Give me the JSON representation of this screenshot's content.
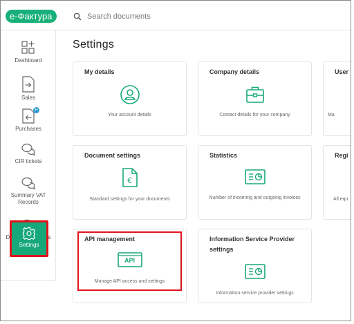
{
  "app": {
    "logo": "e-Фактура"
  },
  "search": {
    "placeholder": "Search documents"
  },
  "page": {
    "title": "Settings"
  },
  "sidebar": {
    "items": [
      {
        "label": "Dashboard"
      },
      {
        "label": "Sales"
      },
      {
        "label": "Purchases",
        "badge": "9+"
      },
      {
        "label": "CIR tickets"
      },
      {
        "label": "Summary VAT Records"
      },
      {
        "label": "Document records"
      },
      {
        "label": "Settings",
        "active": true
      }
    ]
  },
  "cards": [
    {
      "title": "My details",
      "description": "Your account details",
      "icon": "user-icon"
    },
    {
      "title": "Company details",
      "description": "Contact details for your company",
      "icon": "briefcase-icon"
    },
    {
      "title": "User",
      "description": "Ma",
      "icon": "users-icon"
    },
    {
      "title": "Document settings",
      "description": "Standard settings for your documents",
      "icon": "euro-document-icon"
    },
    {
      "title": "Statistics",
      "description": "Number of incoming and outgoing invoices",
      "icon": "statistics-icon"
    },
    {
      "title": "Regi",
      "description": "All equ",
      "icon": "register-icon"
    },
    {
      "title": "API management",
      "description": "Manage API access and settings",
      "icon": "api-icon",
      "icon_text": "API",
      "highlighted": true
    },
    {
      "title": "Information Service Provider settings",
      "description": "Information service provider settings",
      "icon": "statistics-icon"
    }
  ],
  "colors": {
    "accent": "#17a87a",
    "highlight": "#e0121b",
    "badge": "#2e9bd6"
  }
}
